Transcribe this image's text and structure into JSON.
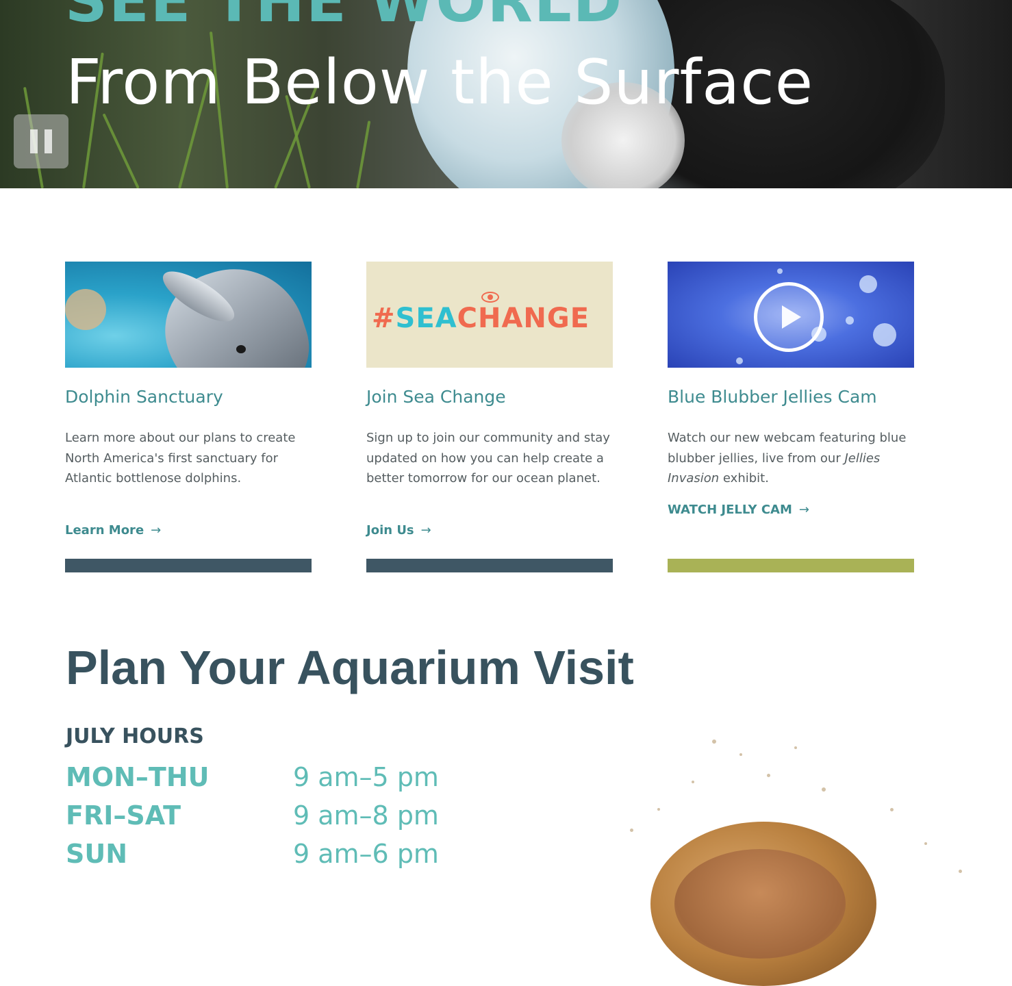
{
  "hero": {
    "headline_top": "SEE THE WORLD",
    "headline_main": "From Below the Surface",
    "pause_icon": "pause-icon"
  },
  "cards": [
    {
      "title": "Dolphin Sanctuary",
      "text": "Learn more about our plans to create North America's first sanctuary for Atlantic bottlenose dolphins.",
      "cta": "Learn More",
      "rule_color": "#3f5765"
    },
    {
      "image_text_hash": "#",
      "image_text_sea": "SEA",
      "image_text_change": "CHANGE",
      "title": "Join Sea Change",
      "text": "Sign up to join our community and stay updated on how you can help create a better tomorrow for our ocean planet.",
      "cta": "Join Us",
      "rule_color": "#3f5765"
    },
    {
      "title": "Blue Blubber Jellies Cam",
      "text_before": "Watch our new webcam featuring blue blubber jellies, live from our ",
      "text_em": "Jellies Invasion",
      "text_after": " exhibit.",
      "cta": "WATCH JELLY CAM",
      "rule_color": "#a9b256"
    }
  ],
  "cta_arrow": "→",
  "plan": {
    "title": "Plan Your Aquarium Visit",
    "hours_heading": "JULY HOURS",
    "hours": [
      {
        "day": "MON–THU",
        "time": "9 am–5 pm"
      },
      {
        "day": "FRI–SAT",
        "time": "9 am–8 pm"
      },
      {
        "day": "SUN",
        "time": "9 am–6 pm"
      }
    ]
  }
}
